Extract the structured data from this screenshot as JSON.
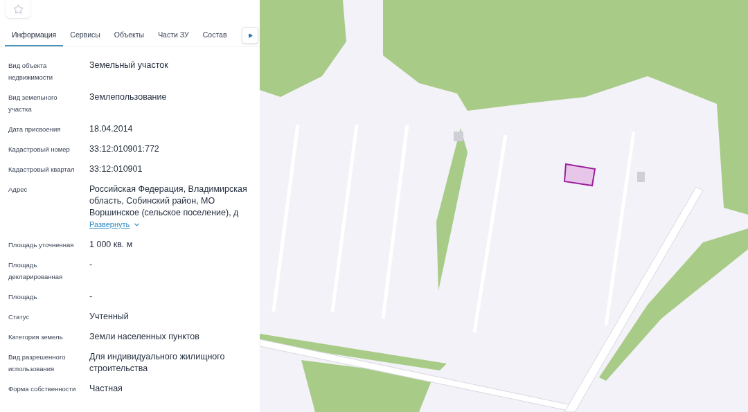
{
  "tabs": [
    {
      "label": "Информация",
      "selected": true
    },
    {
      "label": "Сервисы",
      "selected": false
    },
    {
      "label": "Объекты",
      "selected": false
    },
    {
      "label": "Части ЗУ",
      "selected": false
    },
    {
      "label": "Состав",
      "selected": false
    }
  ],
  "fields": [
    {
      "label": "Вид объекта недвижимости",
      "value": "Земельный участок"
    },
    {
      "label": "Вид земельного участка",
      "value": "Землепользование"
    },
    {
      "label": "Дата присвоения",
      "value": "18.04.2014"
    },
    {
      "label": "Кадастровый номер",
      "value": "33:12:010901:772"
    },
    {
      "label": "Кадастровый квартал",
      "value": "33:12:010901"
    },
    {
      "label": "Адрес",
      "value": "Российская Федерация, Владимирская область, Собинский район, МО Воршинское (сельское поселение), д",
      "expand_link": "Развернуть"
    },
    {
      "label": "Площадь уточненная",
      "value": "1 000 кв. м"
    },
    {
      "label": "Площадь декларированная",
      "value": "-"
    },
    {
      "label": "Площадь",
      "value": "-"
    },
    {
      "label": "Статус",
      "value": "Учтенный"
    },
    {
      "label": "Категория земель",
      "value": "Земли населенных пунктов"
    },
    {
      "label": "Вид разрешенного использования",
      "value": "Для индивидуального жилищного строительства"
    },
    {
      "label": "Форма собственности",
      "value": "Частная"
    }
  ]
}
